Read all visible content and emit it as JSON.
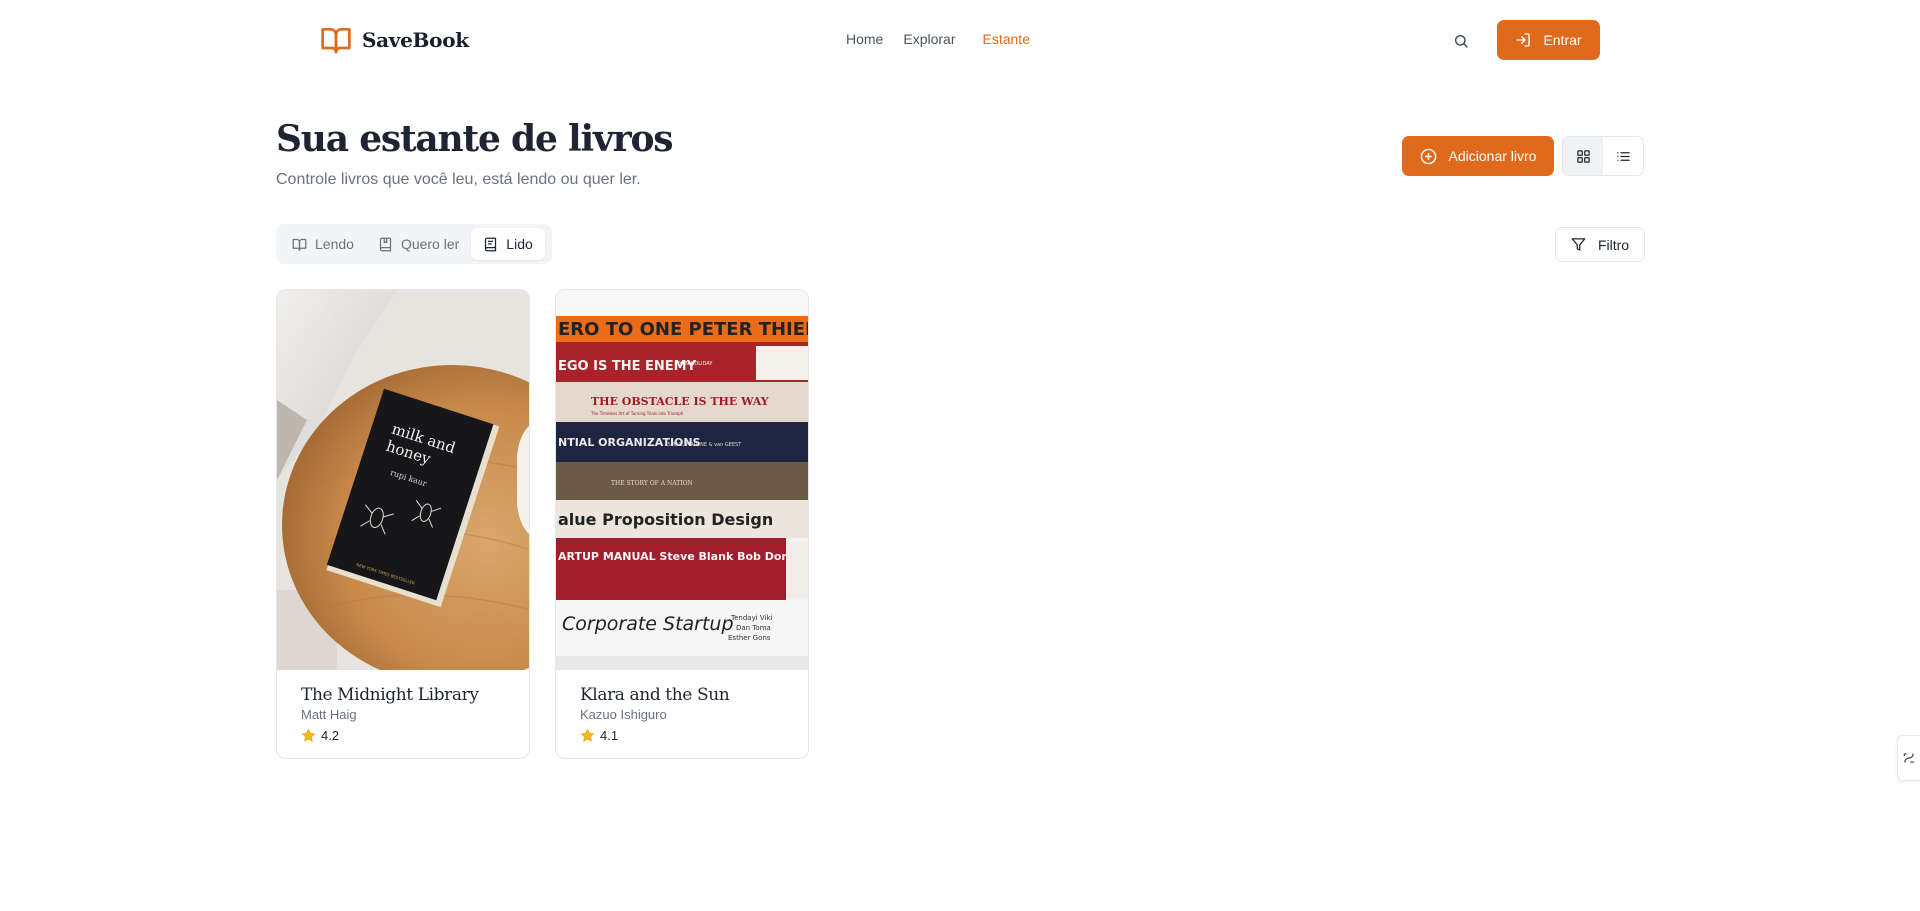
{
  "brand": {
    "name": "SaveBook",
    "accent": "#e06a1b"
  },
  "nav": {
    "home": "Home",
    "explore": "Explorar",
    "shelf": "Estante"
  },
  "header": {
    "login_label": "Entrar"
  },
  "page": {
    "title": "Sua estante de livros",
    "subtitle": "Controle livros que você leu, está lendo ou quer ler.",
    "add_label": "Adicionar livro",
    "filter_label": "Filtro"
  },
  "tabs": [
    {
      "label": "Lendo",
      "icon": "open-book-icon"
    },
    {
      "label": "Quero ler",
      "icon": "bookmark-icon"
    },
    {
      "label": "Lido",
      "icon": "book-text-icon",
      "active": true
    }
  ],
  "books": [
    {
      "title": "The Midnight Library",
      "author": "Matt Haig",
      "rating": "4.2"
    },
    {
      "title": "Klara and the Sun",
      "author": "Kazuo Ishiguro",
      "rating": "4.1"
    }
  ],
  "covers": {
    "book1": {
      "line1": "milk and",
      "line2": "honey",
      "author": "rupi kaur",
      "footer": "NEW YORK TIMES BESTSELLER"
    },
    "book2": {
      "spines": [
        "ERO TO ONE   PETER THIEL",
        "EGO IS THE ENEMY",
        "THE OBSTACLE IS THE WAY",
        "NTIAL ORGANIZATIONS",
        "THE STORY OF A NATION",
        "alue Proposition Design",
        "ARTUP MANUAL  Steve Blank Bob Dorf",
        "Corporate Startup"
      ],
      "small": [
        "RYAN HOLIDAY",
        "The Timeless Art of Turning Trials into Triumph",
        "ISMAIL, MALONE & van GEEST",
        "Tendayi Viki",
        "Dan Toma",
        "Esther Gons"
      ]
    }
  }
}
